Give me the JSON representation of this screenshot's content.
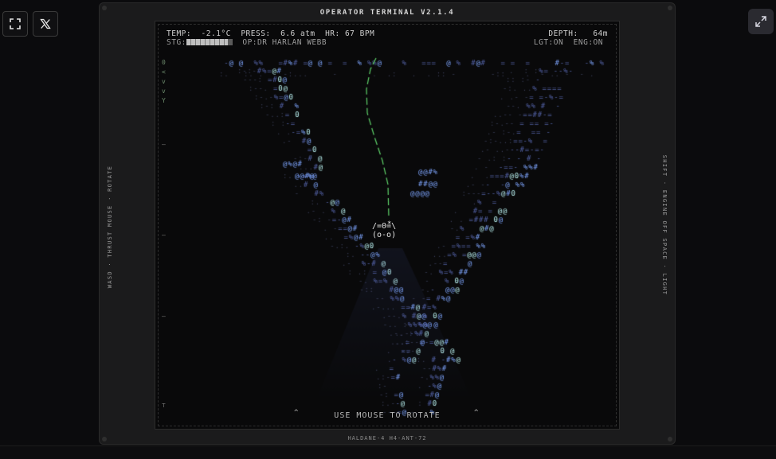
{
  "device": {
    "title": "OPERATOR TERMINAL V2.1.4",
    "footer": "HALDANE-4 H4-ANT-72",
    "left_controls": "WASD · THRUST     MOUSE · ROTATE",
    "right_controls": "SHIFT · ENGINE OFF     SPACE · LIGHT"
  },
  "hud": {
    "temp": "TEMP:  -2.1°C",
    "press": "PRESS:  6.6 atm",
    "hr": "HR: 67 BPM",
    "depth": "DEPTH:   64m",
    "stg_label": "STG:",
    "operator": "OP:DR HARLAN WEBB",
    "lgt": "LGT:ON",
    "eng": "ENG:ON"
  },
  "compass": [
    "0",
    "<",
    "v",
    "v",
    "Y"
  ],
  "hint": "USE MOUSE TO ROTATE",
  "sub": {
    "marker": "*",
    "line1": "/=0=\\",
    "line2": "(o-o)"
  },
  "colors": {
    "background": "#09090a",
    "glyph_dim": "#3a3f5a",
    "glyph_mid": "#5463a8",
    "glyph_bright": "#7fa6ff",
    "glyph_highlight": "#b9f1f0",
    "tether": "#5fd46a"
  },
  "icons": {
    "fullscreen": "fullscreen-icon",
    "x_logo": "x-logo-icon",
    "expand": "expand-icon"
  }
}
